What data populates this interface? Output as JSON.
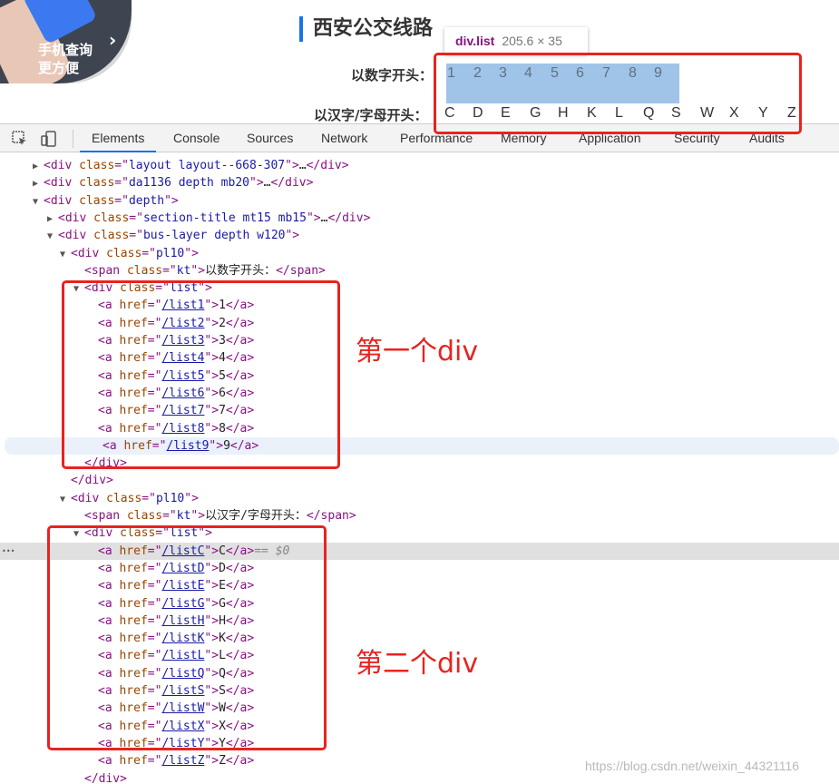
{
  "page": {
    "promo_line1": "手机查询",
    "promo_line2": "更方便",
    "title": "西安公交线路",
    "row_numbers_label": "以数字开头：",
    "row_letters_label": "以汉字/字母开头：",
    "numbers": [
      "1",
      "2",
      "3",
      "4",
      "5",
      "6",
      "7",
      "8",
      "9"
    ],
    "letters": [
      "C",
      "D",
      "E",
      "G",
      "H",
      "K",
      "L",
      "Q",
      "S",
      "W",
      "X",
      "Y",
      "Z"
    ]
  },
  "tooltip": {
    "tag": "div.list",
    "dims": "205.6 × 35"
  },
  "annotations": {
    "div1": "第一个div",
    "div2": "第二个div"
  },
  "devtools": {
    "tabs": [
      "Elements",
      "Console",
      "Sources",
      "Network",
      "Performance",
      "Memory",
      "Application",
      "Security",
      "Audits"
    ],
    "active_tab": "Elements"
  },
  "tree": {
    "layout_class": "layout layout--668-307",
    "da_class": "da1136 depth mb20",
    "depth_class": "depth",
    "section_class": "section-title mt15 mb15",
    "bus_class": "bus-layer depth w120",
    "pl_class": "pl10",
    "kt_class": "kt",
    "span1_text": "以数字开头：",
    "span2_text": "以汉字/字母开头：",
    "list_class": "list",
    "list1_links": [
      {
        "href": "/list1",
        "text": "1"
      },
      {
        "href": "/list2",
        "text": "2"
      },
      {
        "href": "/list3",
        "text": "3"
      },
      {
        "href": "/list4",
        "text": "4"
      },
      {
        "href": "/list5",
        "text": "5"
      },
      {
        "href": "/list6",
        "text": "6"
      },
      {
        "href": "/list7",
        "text": "7"
      },
      {
        "href": "/list8",
        "text": "8"
      },
      {
        "href": "/list9",
        "text": "9"
      }
    ],
    "list2_links": [
      {
        "href": "/listC",
        "text": "C"
      },
      {
        "href": "/listD",
        "text": "D"
      },
      {
        "href": "/listE",
        "text": "E"
      },
      {
        "href": "/listG",
        "text": "G"
      },
      {
        "href": "/listH",
        "text": "H"
      },
      {
        "href": "/listK",
        "text": "K"
      },
      {
        "href": "/listL",
        "text": "L"
      },
      {
        "href": "/listQ",
        "text": "Q"
      },
      {
        "href": "/listS",
        "text": "S"
      },
      {
        "href": "/listW",
        "text": "W"
      },
      {
        "href": "/listX",
        "text": "X"
      },
      {
        "href": "/listY",
        "text": "Y"
      },
      {
        "href": "/listZ",
        "text": "Z"
      }
    ],
    "selected_marker": "== $0"
  },
  "watermark": "https://blog.csdn.net/weixin_44321116"
}
